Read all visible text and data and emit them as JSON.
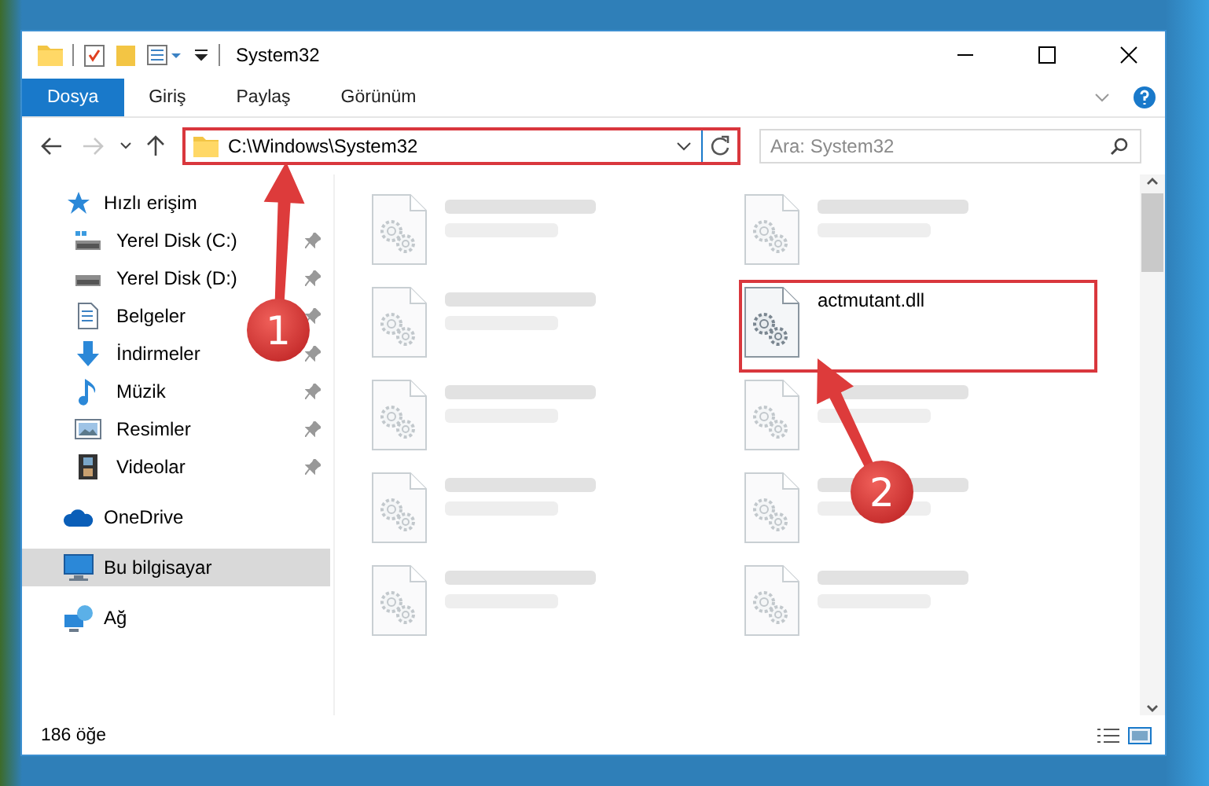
{
  "window": {
    "title": "System32"
  },
  "ribbon_tabs": [
    {
      "label": "Dosya",
      "selected": true
    },
    {
      "label": "Giriş",
      "selected": false
    },
    {
      "label": "Paylaş",
      "selected": false
    },
    {
      "label": "Görünüm",
      "selected": false
    }
  ],
  "address_bar": {
    "path": "C:\\Windows\\System32",
    "highlighted": true
  },
  "search": {
    "placeholder": "Ara: System32"
  },
  "nav_pane": {
    "items": [
      {
        "label": "Hızlı erişim",
        "kind": "star",
        "selected": false,
        "children": [
          {
            "label": "Yerel Disk (C:)",
            "kind": "drive-c",
            "pinned": true,
            "selected": false
          },
          {
            "label": "Yerel Disk (D:)",
            "kind": "drive",
            "pinned": true,
            "selected": false
          },
          {
            "label": "Belgeler",
            "kind": "document",
            "pinned": true,
            "selected": false
          },
          {
            "label": "İndirmeler",
            "kind": "download",
            "pinned": true,
            "selected": false
          },
          {
            "label": "Müzik",
            "kind": "music",
            "pinned": true,
            "selected": false
          },
          {
            "label": "Resimler",
            "kind": "picture",
            "pinned": true,
            "selected": false
          },
          {
            "label": "Videolar",
            "kind": "video",
            "pinned": true,
            "selected": false
          }
        ]
      },
      {
        "label": "OneDrive",
        "kind": "cloud",
        "selected": false
      },
      {
        "label": "Bu bilgisayar",
        "kind": "computer",
        "selected": true
      },
      {
        "label": "Ağ",
        "kind": "network",
        "selected": false
      }
    ]
  },
  "files": [
    {
      "blurred": true,
      "highlighted": false
    },
    {
      "blurred": true,
      "highlighted": false
    },
    {
      "blurred": true,
      "highlighted": false
    },
    {
      "name": "actmutant.dll",
      "blurred": false,
      "highlighted": true
    },
    {
      "blurred": true,
      "highlighted": false
    },
    {
      "blurred": true,
      "highlighted": false
    },
    {
      "blurred": true,
      "highlighted": false
    },
    {
      "blurred": true,
      "highlighted": false
    },
    {
      "blurred": true,
      "highlighted": false
    },
    {
      "blurred": true,
      "highlighted": false
    }
  ],
  "status_bar": {
    "item_count": "186 öğe"
  },
  "annotations": [
    {
      "label": "1"
    },
    {
      "label": "2"
    }
  ]
}
